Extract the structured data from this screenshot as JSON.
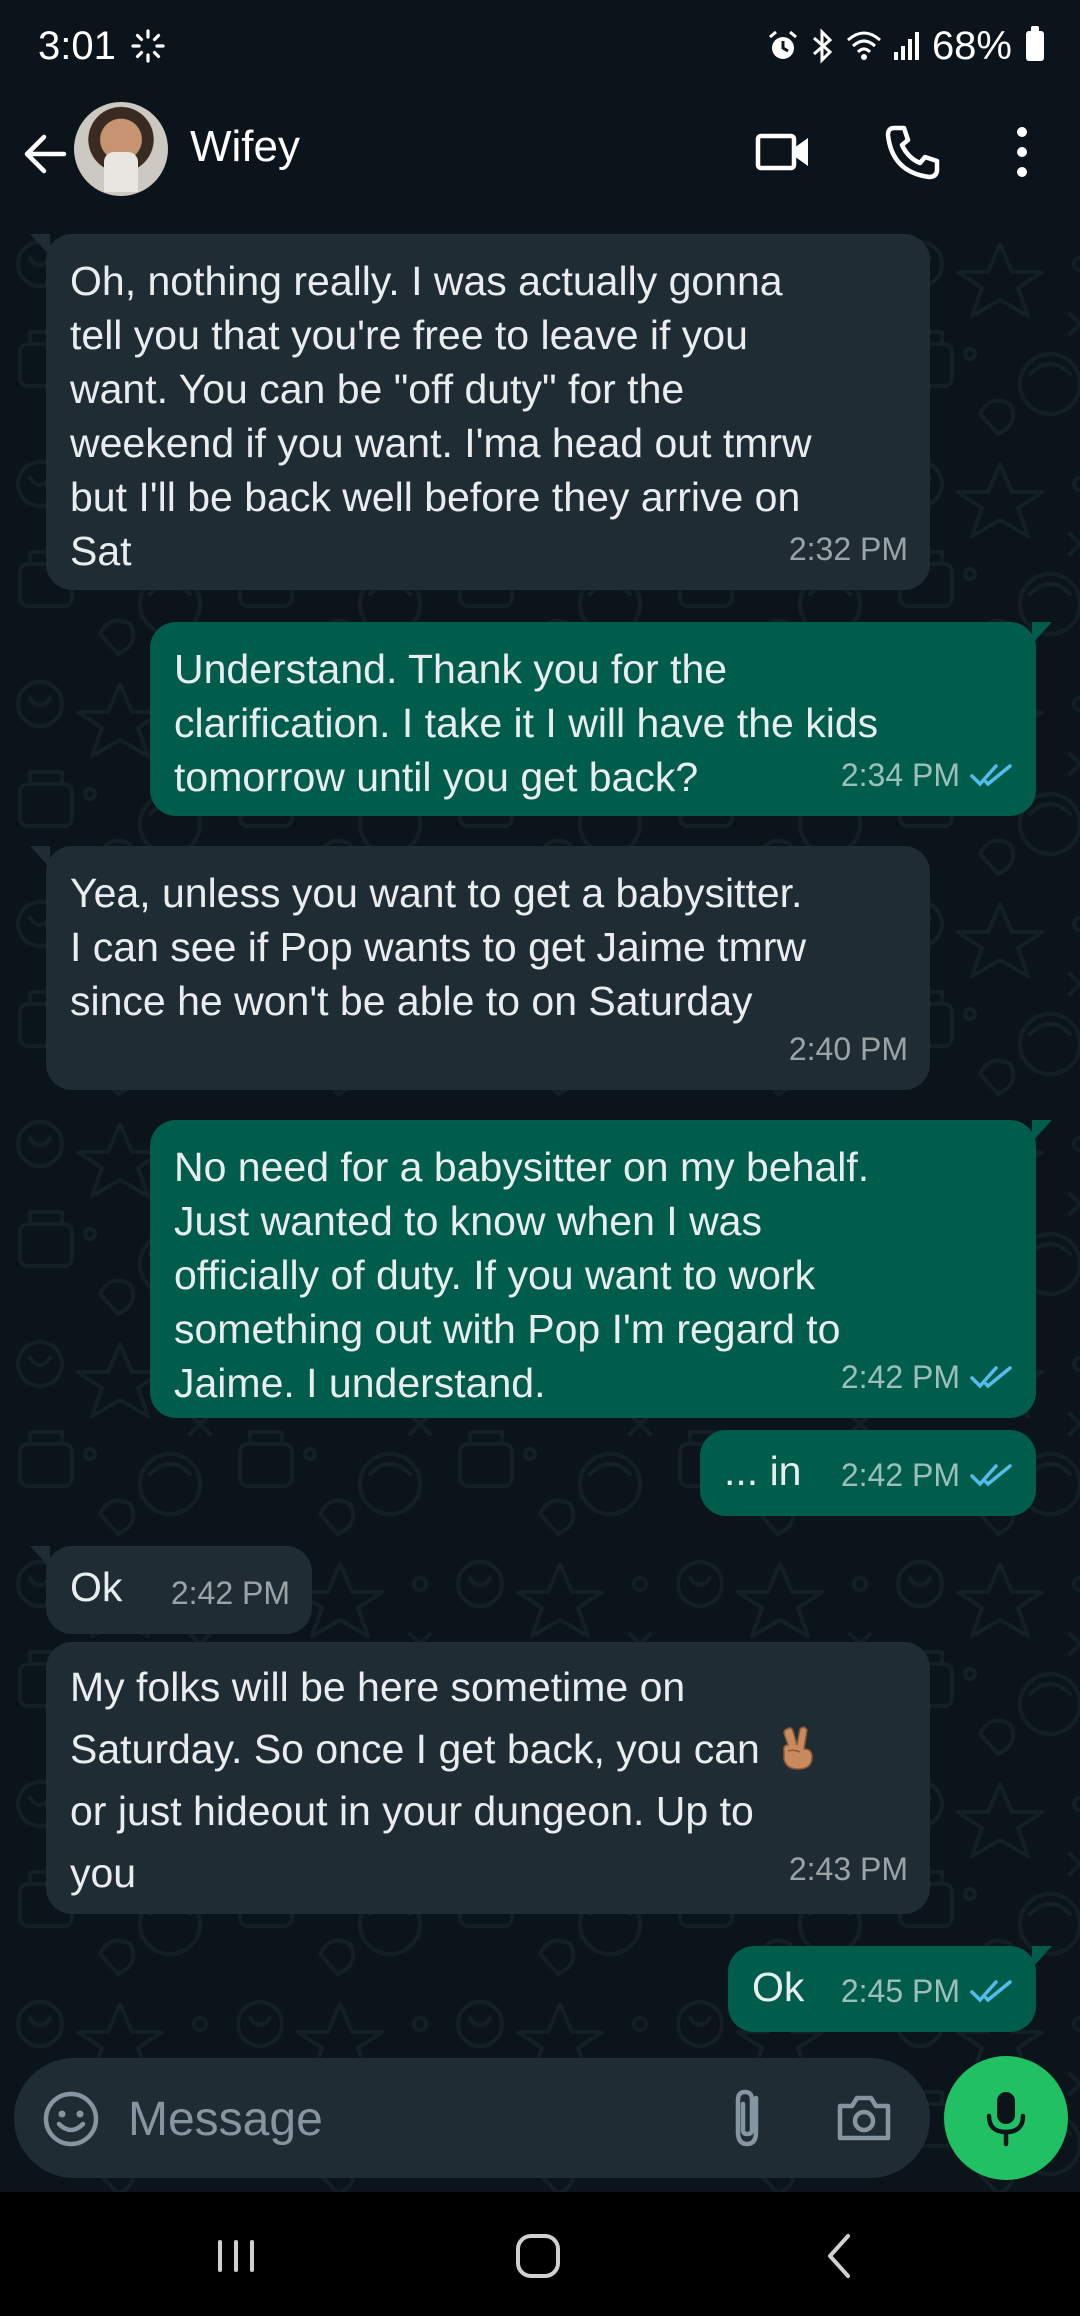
{
  "status": {
    "time": "3:01",
    "battery": "68%"
  },
  "header": {
    "contact_name": "Wifey"
  },
  "messages": [
    {
      "direction": "incoming",
      "text": "Oh, nothing really. I was actually gonna\ntell you that you're free to leave if you\nwant. You can be \"off duty\" for the\nweekend if you want. I'ma head out tmrw\nbut I'll be back well before they arrive on\nSat",
      "time": "2:32 PM"
    },
    {
      "direction": "outgoing",
      "text": "Understand. Thank you for the\nclarification. I take it I will have the kids\ntomorrow until you get back?",
      "time": "2:34 PM",
      "status": "read"
    },
    {
      "direction": "incoming",
      "text": "Yea, unless you want to get a babysitter.\nI can see if Pop wants to get Jaime tmrw\nsince he won't be able to on Saturday",
      "time": "2:40 PM"
    },
    {
      "direction": "outgoing",
      "text": "No need for a babysitter on my behalf.\nJust wanted to know when I was\nofficially of duty. If you want to work\nsomething out with Pop I'm regard to\nJaime. I understand.",
      "time": "2:42 PM",
      "status": "read"
    },
    {
      "direction": "outgoing",
      "text": "... in",
      "time": "2:42 PM",
      "status": "read"
    },
    {
      "direction": "incoming",
      "text": "Ok",
      "time": "2:42 PM"
    },
    {
      "direction": "incoming",
      "text_line1": "My folks will be here sometime on",
      "text_line2": "Saturday. So once I get back, you can",
      "emoji": "victory-hand-emoji",
      "text_rest": "or just hideout in your dungeon. Up to\nyou",
      "time": "2:43 PM"
    },
    {
      "direction": "outgoing",
      "text": "Ok",
      "time": "2:45 PM",
      "status": "read"
    }
  ],
  "composer": {
    "placeholder": "Message"
  },
  "colors": {
    "background": "#0b141a",
    "incoming_bubble": "#202c33",
    "outgoing_bubble": "#005c4b",
    "read_ticks": "#53bdeb",
    "mic_button": "#21c063"
  }
}
